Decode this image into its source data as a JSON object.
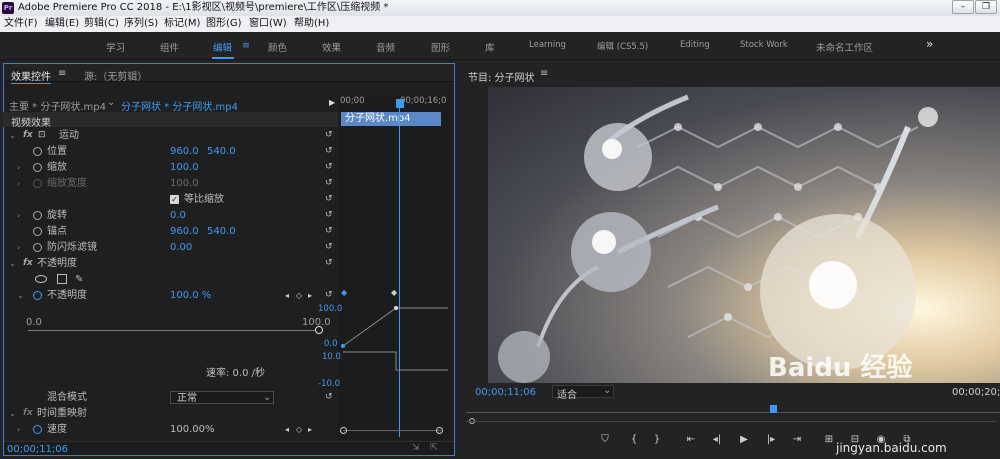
{
  "titlebar": {
    "title": "Adobe Premiere Pro CC 2018 - E:\\1影视区\\视频号\\premiere\\工作区\\压缩视频 *",
    "minimize": "–",
    "restore": "❐",
    "close": "✕"
  },
  "menu": [
    "文件(F)",
    "编辑(E)",
    "剪辑(C)",
    "序列(S)",
    "标记(M)",
    "图形(G)",
    "窗口(W)",
    "帮助(H)"
  ],
  "workspaces": [
    "学习",
    "组件",
    "编辑",
    "颜色",
    "效果",
    "音频",
    "图形",
    "库",
    "Learning",
    "编辑 (CS5.5)",
    "Editing",
    "Stock Work",
    "未命名工作区"
  ],
  "workspace_more": "»",
  "effect_panel": {
    "tab_active": "效果控件",
    "tab_source": "源:（无剪辑）",
    "master_label": "主要 * 分子网状.mp4",
    "clip_label": "分子网状 * 分子网状.mp4",
    "tl_time_start": "00;00",
    "tl_time_end": "00;00;16;0",
    "clip_bar_label": "分子网状.mp4",
    "section_video": "视频效果",
    "motion": "运动",
    "position": "位置",
    "position_x": "960.0",
    "position_y": "540.0",
    "scale": "缩放",
    "scale_value": "100.0",
    "scale_width": "缩放宽度",
    "scale_width_value": "100.0",
    "uniform_scale": "等比缩放",
    "rotation": "旋转",
    "rotation_value": "0.0",
    "anchor": "锚点",
    "anchor_x": "960.0",
    "anchor_y": "540.0",
    "antiflicker": "防闪烁滤镜",
    "antiflicker_value": "0.00",
    "opacity_section": "不透明度",
    "opacity": "不透明度",
    "opacity_value": "100.0 %",
    "slider_min": "0.0",
    "slider_max": "100.0",
    "graph_top": "100.0",
    "graph_mid": "0.0",
    "velocity_top": "10.0",
    "velocity_bottom": "-10.0",
    "velocity_label": "速率: 0.0 /秒",
    "blend_mode": "混合模式",
    "blend_value": "正常",
    "time_remap": "时间重映射",
    "speed": "速度",
    "speed_value": "100.00%",
    "timecode": "00;00;11;06"
  },
  "program": {
    "title": "节目: 分子网状",
    "timecode": "00;00;11;06",
    "fit": "适合",
    "end_timecode": "00;00;20;0",
    "watermark_main": "Baidu 经验",
    "watermark_url": "jingyan.baidu.com"
  },
  "colors": {
    "accent": "#3d9bf4",
    "panel": "#1f1f1f"
  }
}
